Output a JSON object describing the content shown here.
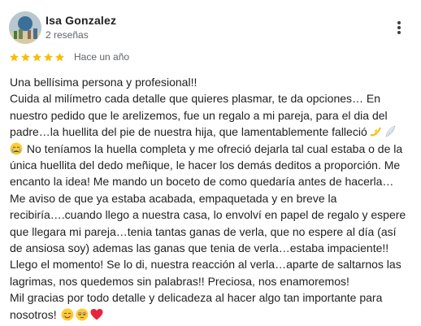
{
  "reviewer": {
    "name": "Isa Gonzalez",
    "review_count": "2 reseñas"
  },
  "review": {
    "rating": 5,
    "rating_max": 5,
    "time": "Hace un año",
    "lines": [
      "Una bellísima persona y profesional!!",
      "Cuida al milímetro cada detalle que quieres plasmar, te da opciones… En",
      "nuestro pedido que le arelizemos, fue un regalo a mi pareja, para el dia del",
      "padre…la huellita del pie de nuestra hija, que lamentablemente falleció",
      " No teníamos la huella completa y me ofreció dejarla tal cual estaba o de la",
      "única huellita del dedo meñique, le hacer los demás deditos a proporción. Me",
      "encanto la idea! Me mando un boceto de como quedaría antes de hacerla…",
      "Me aviso de que ya estaba acabada, empaquetada y en breve la",
      "recibiría….cuando llego a nuestra casa, lo envolví en papel de regalo y espere",
      "que llegara mi pareja…tenia tantas ganas de verla, que no espere al día (así",
      "de ansiosa soy) ademas las ganas que tenia de verla…estaba impaciente!!",
      "Llego el momento! Se lo di, nuestra reacción al verla…aparte de saltarnos las",
      "lagrimas, nos quedemos sin palabras!! Preciosa, nos enamoremos!",
      "Mil gracias por todo detalle y delicadeza al hacer algo tan importante para",
      "nosotros! "
    ]
  },
  "icons": {
    "star": "star-icon",
    "menu": "more-vert-icon",
    "emojis": [
      "dizzy-emoji",
      "wing-emoji",
      "crying-face-emoji",
      "smiling-face-emoji",
      "holding-back-tears-emoji",
      "red-heart-emoji"
    ]
  },
  "colors": {
    "star": "#fbbc04",
    "text": "#202124",
    "meta": "#5f6368",
    "heart": "#e8243b"
  }
}
